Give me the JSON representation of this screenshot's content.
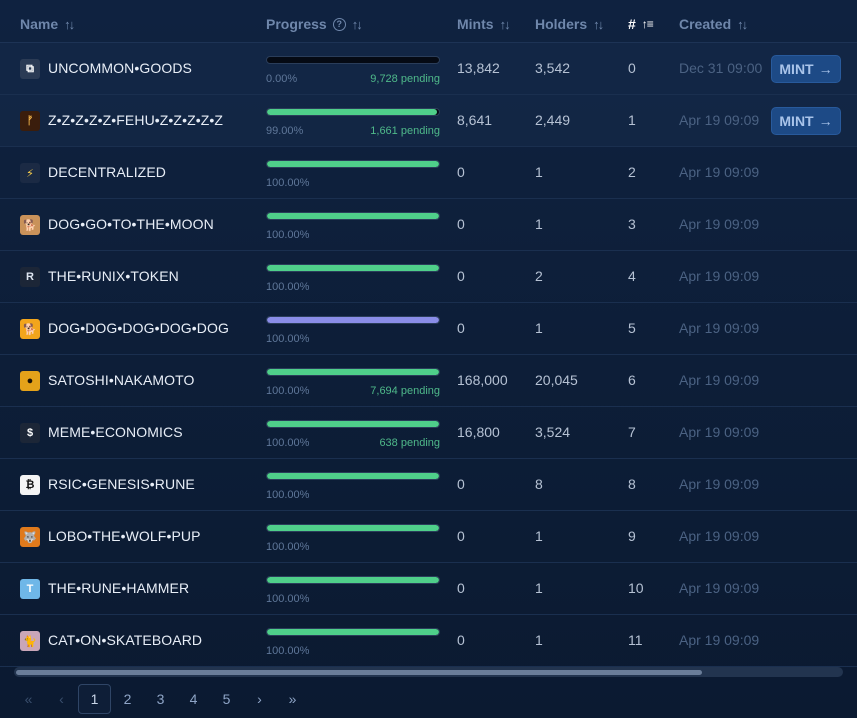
{
  "header": {
    "name": "Name",
    "progress": "Progress",
    "mints": "Mints",
    "holders": "Holders",
    "number": "#",
    "created": "Created"
  },
  "icons": {
    "sort": "sort-arrows-icon",
    "sort_active": "sort-ascending-icon",
    "help": "help-circle-icon"
  },
  "colors": {
    "progress_fill": "#4fcf8a",
    "progress_fill_alt": "#8a8de8",
    "mint_button": "#1d4a86",
    "pending_text": "#4fb98a"
  },
  "rows": [
    {
      "name": "UNCOMMON•GOODS",
      "progress": 0.0,
      "percent": "0.00%",
      "pending": "9,728 pending",
      "mints": "13,842",
      "holders": "3,542",
      "number": "0",
      "created": "Dec 31 09:00",
      "mint_label": "MINT",
      "icon": "⧉",
      "icon_bg": "#2b3b55",
      "icon_fg": "#ffffff"
    },
    {
      "name": "Z•Z•Z•Z•Z•FEHU•Z•Z•Z•Z•Z",
      "progress": 0.99,
      "percent": "99.00%",
      "pending": "1,661 pending",
      "mints": "8,641",
      "holders": "2,449",
      "number": "1",
      "created": "Apr 19 09:09",
      "mint_label": "MINT",
      "icon": "ᚠ",
      "icon_bg": "#3a1d0c",
      "icon_fg": "#f0b24a"
    },
    {
      "name": "DECENTRALIZED",
      "progress": 1.0,
      "percent": "100.00%",
      "pending": "",
      "mints": "0",
      "holders": "1",
      "number": "2",
      "created": "Apr 19 09:09",
      "mint_label": "",
      "icon": "⚡",
      "icon_bg": "#1b2a44",
      "icon_fg": "#ffd24a"
    },
    {
      "name": "DOG•GO•TO•THE•MOON",
      "progress": 1.0,
      "percent": "100.00%",
      "pending": "",
      "mints": "0",
      "holders": "1",
      "number": "3",
      "created": "Apr 19 09:09",
      "mint_label": "",
      "icon": "🐕",
      "icon_bg": "#c9925a",
      "icon_fg": "#5a3a1c"
    },
    {
      "name": "THE•RUNIX•TOKEN",
      "progress": 1.0,
      "percent": "100.00%",
      "pending": "",
      "mints": "0",
      "holders": "2",
      "number": "4",
      "created": "Apr 19 09:09",
      "mint_label": "",
      "icon": "R",
      "icon_bg": "#1c2637",
      "icon_fg": "#dfe6f0"
    },
    {
      "name": "DOG•DOG•DOG•DOG•DOG",
      "progress": 1.0,
      "percent": "100.00%",
      "pending": "",
      "mints": "0",
      "holders": "1",
      "number": "5",
      "created": "Apr 19 09:09",
      "mint_label": "",
      "icon": "🐕",
      "icon_bg": "#f2a51c",
      "icon_fg": "#3a2a10"
    },
    {
      "name": "SATOSHI•NAKAMOTO",
      "progress": 1.0,
      "percent": "100.00%",
      "pending": "7,694 pending",
      "mints": "168,000",
      "holders": "20,045",
      "number": "6",
      "created": "Apr 19 09:09",
      "mint_label": "",
      "icon": "●",
      "icon_bg": "#e4a21a",
      "icon_fg": "#1a1208"
    },
    {
      "name": "MEME•ECONOMICS",
      "progress": 1.0,
      "percent": "100.00%",
      "pending": "638 pending",
      "mints": "16,800",
      "holders": "3,524",
      "number": "7",
      "created": "Apr 19 09:09",
      "mint_label": "",
      "icon": "$",
      "icon_bg": "#1c2637",
      "icon_fg": "#ffffff"
    },
    {
      "name": "RSIC•GENESIS•RUNE",
      "progress": 1.0,
      "percent": "100.00%",
      "pending": "",
      "mints": "0",
      "holders": "8",
      "number": "8",
      "created": "Apr 19 09:09",
      "mint_label": "",
      "icon": "₿",
      "icon_bg": "#f4f4f4",
      "icon_fg": "#111111"
    },
    {
      "name": "LOBO•THE•WOLF•PUP",
      "progress": 1.0,
      "percent": "100.00%",
      "pending": "",
      "mints": "0",
      "holders": "1",
      "number": "9",
      "created": "Apr 19 09:09",
      "mint_label": "",
      "icon": "🐺",
      "icon_bg": "#e07a1c",
      "icon_fg": "#3a1d06"
    },
    {
      "name": "THE•RUNE•HAMMER",
      "progress": 1.0,
      "percent": "100.00%",
      "pending": "",
      "mints": "0",
      "holders": "1",
      "number": "10",
      "created": "Apr 19 09:09",
      "mint_label": "",
      "icon": "T",
      "icon_bg": "#6fb7e8",
      "icon_fg": "#ffffff"
    },
    {
      "name": "CAT•ON•SKATEBOARD",
      "progress": 1.0,
      "percent": "100.00%",
      "pending": "",
      "mints": "0",
      "holders": "1",
      "number": "11",
      "created": "Apr 19 09:09",
      "mint_label": "",
      "icon": "🐈",
      "icon_bg": "#c9a6b8",
      "icon_fg": "#3a2030"
    }
  ],
  "pagination": {
    "first": "«",
    "prev": "‹",
    "pages": [
      "1",
      "2",
      "3",
      "4",
      "5"
    ],
    "current": "1",
    "next": "›",
    "last": "»"
  }
}
